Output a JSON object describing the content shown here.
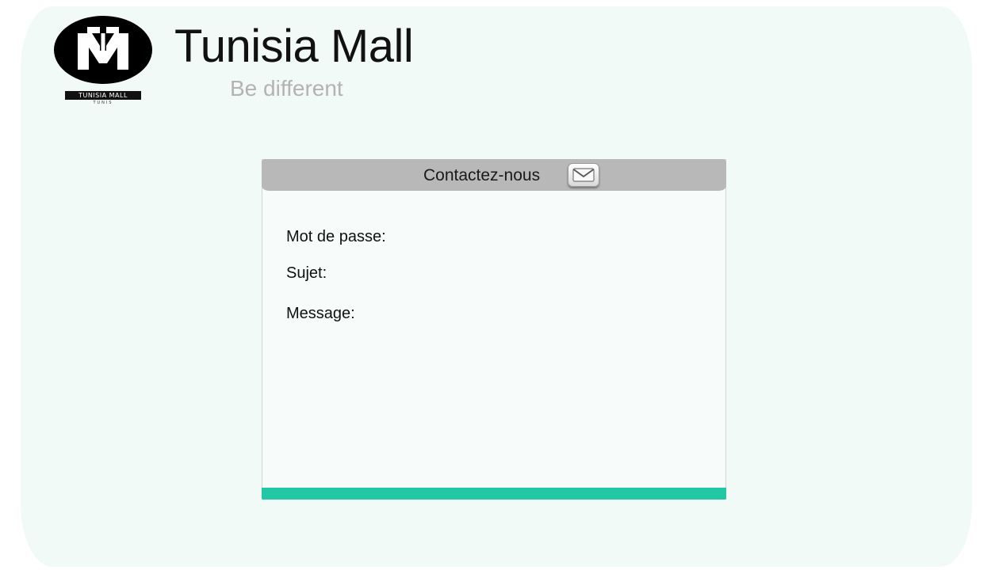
{
  "brand": {
    "title": "Tunisia Mall",
    "tagline": "Be different",
    "logo_caption": "TUNISIA MALL",
    "logo_subcaption": "TUNIS",
    "logo_icon": "tm-monogram-logo"
  },
  "contact_panel": {
    "title": "Contactez-nous",
    "mail_icon": "envelope-icon",
    "labels": {
      "password": "Mot de passe:",
      "subject": "Sujet:",
      "message": "Message:"
    }
  },
  "colors": {
    "background": "#f2faf7",
    "panel_header": "#b8b8b8",
    "panel_footer": "#22c7a4",
    "tagline": "#b3b3b3"
  }
}
